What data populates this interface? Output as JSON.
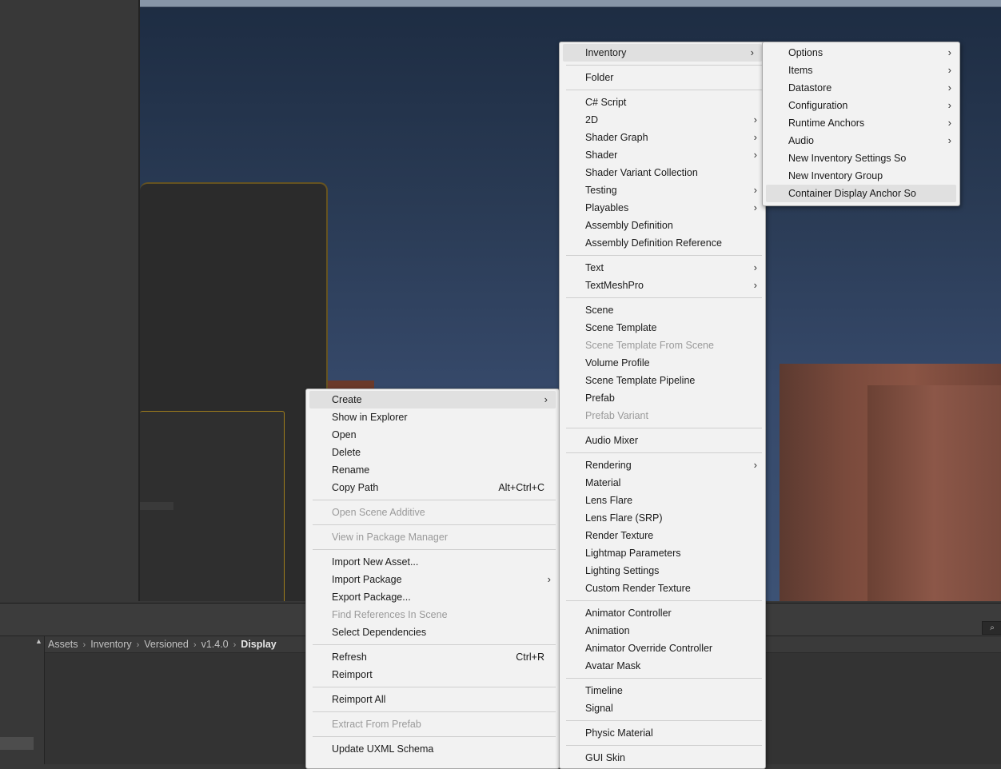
{
  "project": {
    "breadcrumb": [
      "Assets",
      "Inventory",
      "Versioned",
      "v1.4.0",
      "Display"
    ],
    "search_icon": "⌕"
  },
  "context_menu": [
    {
      "label": "Create",
      "submenu": true,
      "highlighted": true
    },
    {
      "label": "Show in Explorer"
    },
    {
      "label": "Open"
    },
    {
      "label": "Delete"
    },
    {
      "label": "Rename"
    },
    {
      "label": "Copy Path",
      "shortcut": "Alt+Ctrl+C"
    },
    {
      "separator": true
    },
    {
      "label": "Open Scene Additive",
      "disabled": true
    },
    {
      "separator": true
    },
    {
      "label": "View in Package Manager",
      "disabled": true
    },
    {
      "separator": true
    },
    {
      "label": "Import New Asset..."
    },
    {
      "label": "Import Package",
      "submenu": true
    },
    {
      "label": "Export Package..."
    },
    {
      "label": "Find References In Scene",
      "disabled": true
    },
    {
      "label": "Select Dependencies"
    },
    {
      "separator": true
    },
    {
      "label": "Refresh",
      "shortcut": "Ctrl+R"
    },
    {
      "label": "Reimport"
    },
    {
      "separator": true
    },
    {
      "label": "Reimport All"
    },
    {
      "separator": true
    },
    {
      "label": "Extract From Prefab",
      "disabled": true
    },
    {
      "separator": true
    },
    {
      "label": "Update UXML Schema"
    }
  ],
  "create_menu": [
    {
      "label": "Inventory",
      "submenu": true,
      "highlighted": true
    },
    {
      "separator": true
    },
    {
      "label": "Folder"
    },
    {
      "separator": true
    },
    {
      "label": "C# Script"
    },
    {
      "label": "2D",
      "submenu": true
    },
    {
      "label": "Shader Graph",
      "submenu": true
    },
    {
      "label": "Shader",
      "submenu": true
    },
    {
      "label": "Shader Variant Collection"
    },
    {
      "label": "Testing",
      "submenu": true
    },
    {
      "label": "Playables",
      "submenu": true
    },
    {
      "label": "Assembly Definition"
    },
    {
      "label": "Assembly Definition Reference"
    },
    {
      "separator": true
    },
    {
      "label": "Text",
      "submenu": true
    },
    {
      "label": "TextMeshPro",
      "submenu": true
    },
    {
      "separator": true
    },
    {
      "label": "Scene"
    },
    {
      "label": "Scene Template"
    },
    {
      "label": "Scene Template From Scene",
      "disabled": true
    },
    {
      "label": "Volume Profile"
    },
    {
      "label": "Scene Template Pipeline"
    },
    {
      "label": "Prefab"
    },
    {
      "label": "Prefab Variant",
      "disabled": true
    },
    {
      "separator": true
    },
    {
      "label": "Audio Mixer"
    },
    {
      "separator": true
    },
    {
      "label": "Rendering",
      "submenu": true
    },
    {
      "label": "Material"
    },
    {
      "label": "Lens Flare"
    },
    {
      "label": "Lens Flare (SRP)"
    },
    {
      "label": "Render Texture"
    },
    {
      "label": "Lightmap Parameters"
    },
    {
      "label": "Lighting Settings"
    },
    {
      "label": "Custom Render Texture"
    },
    {
      "separator": true
    },
    {
      "label": "Animator Controller"
    },
    {
      "label": "Animation"
    },
    {
      "label": "Animator Override Controller"
    },
    {
      "label": "Avatar Mask"
    },
    {
      "separator": true
    },
    {
      "label": "Timeline"
    },
    {
      "label": "Signal"
    },
    {
      "separator": true
    },
    {
      "label": "Physic Material"
    },
    {
      "separator": true
    },
    {
      "label": "GUI Skin"
    }
  ],
  "inventory_menu": [
    {
      "label": "Options",
      "submenu": true
    },
    {
      "label": "Items",
      "submenu": true
    },
    {
      "label": "Datastore",
      "submenu": true
    },
    {
      "label": "Configuration",
      "submenu": true
    },
    {
      "label": "Runtime Anchors",
      "submenu": true
    },
    {
      "label": "Audio",
      "submenu": true
    },
    {
      "label": "New Inventory Settings So"
    },
    {
      "label": "New Inventory Group"
    },
    {
      "label": "Container Display Anchor So",
      "highlighted": true
    }
  ],
  "arrow_glyph": "›"
}
